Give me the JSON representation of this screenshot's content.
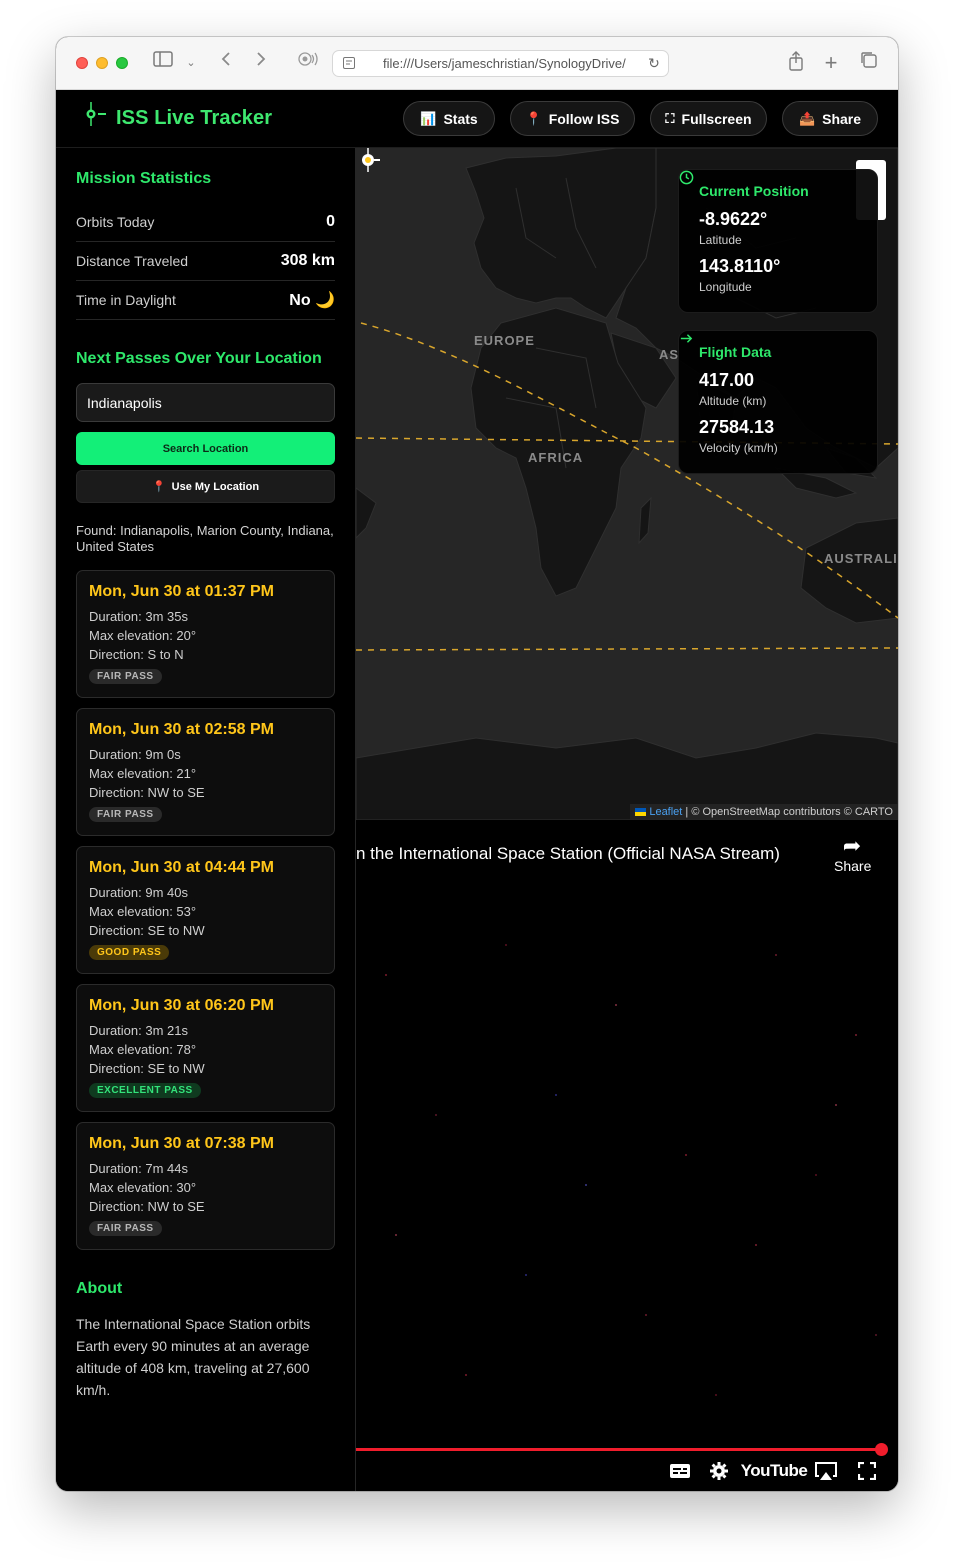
{
  "browser": {
    "url": "file:///Users/jameschristian/SynologyDrive/"
  },
  "header": {
    "title": "ISS Live Tracker",
    "buttons": [
      {
        "icon": "📊",
        "label": "Stats"
      },
      {
        "icon": "📍",
        "label": "Follow ISS"
      },
      {
        "icon": "⛶",
        "label": "Fullscreen"
      },
      {
        "icon": "📤",
        "label": "Share"
      }
    ]
  },
  "sidebar": {
    "mission_title": "Mission Statistics",
    "stats": [
      {
        "label": "Orbits Today",
        "value": "0"
      },
      {
        "label": "Distance Traveled",
        "value": "308 km"
      },
      {
        "label": "Time in Daylight",
        "value": "No 🌙"
      }
    ],
    "passes_title": "Next Passes Over Your Location",
    "location_value": "Indianapolis",
    "search_button": "Search Location",
    "my_location_icon": "📍",
    "my_location_button": "Use My Location",
    "found_text": "Found: Indianapolis, Marion County, Indiana, United States",
    "passes": [
      {
        "time": "Mon, Jun 30 at 01:37 PM",
        "duration": "Duration: 3m 35s",
        "elevation": "Max elevation: 20°",
        "direction": "Direction: S to N",
        "badge": "FAIR PASS",
        "quality": "fair"
      },
      {
        "time": "Mon, Jun 30 at 02:58 PM",
        "duration": "Duration: 9m 0s",
        "elevation": "Max elevation: 21°",
        "direction": "Direction: NW to SE",
        "badge": "FAIR PASS",
        "quality": "fair"
      },
      {
        "time": "Mon, Jun 30 at 04:44 PM",
        "duration": "Duration: 9m 40s",
        "elevation": "Max elevation: 53°",
        "direction": "Direction: SE to NW",
        "badge": "GOOD PASS",
        "quality": "good"
      },
      {
        "time": "Mon, Jun 30 at 06:20 PM",
        "duration": "Duration: 3m 21s",
        "elevation": "Max elevation: 78°",
        "direction": "Direction: SE to NW",
        "badge": "EXCELLENT PASS",
        "quality": "excellent"
      },
      {
        "time": "Mon, Jun 30 at 07:38 PM",
        "duration": "Duration: 7m 44s",
        "elevation": "Max elevation: 30°",
        "direction": "Direction: NW to SE",
        "badge": "FAIR PASS",
        "quality": "fair"
      }
    ],
    "about_title": "About",
    "about_text": "The International Space Station orbits Earth every 90 minutes at an average altitude of 408 km, traveling at 27,600 km/h."
  },
  "map": {
    "labels": [
      "EUROPE",
      "AS",
      "AFRICA",
      "AUSTRALI"
    ],
    "attribution_leaflet": "Leaflet",
    "attribution_rest": " | © OpenStreetMap contributors © CARTO",
    "position_card": {
      "title": "Current Position",
      "latitude": "-8.9622°",
      "latitude_label": "Latitude",
      "longitude": "143.8110°",
      "longitude_label": "Longitude"
    },
    "flight_card": {
      "title": "Flight Data",
      "altitude": "417.00",
      "altitude_label": "Altitude (km)",
      "velocity": "27584.13",
      "velocity_label": "Velocity (km/h)"
    }
  },
  "video": {
    "title": "n the International Space Station (Official NASA Stream)",
    "share_label": "Share",
    "youtube_label": "YouTube",
    "progress": 0.98
  },
  "colors": {
    "accent": "#2ee86b",
    "pass_time": "#ffc61a",
    "search_button": "#13ef78",
    "progress": "#f01d2c"
  }
}
